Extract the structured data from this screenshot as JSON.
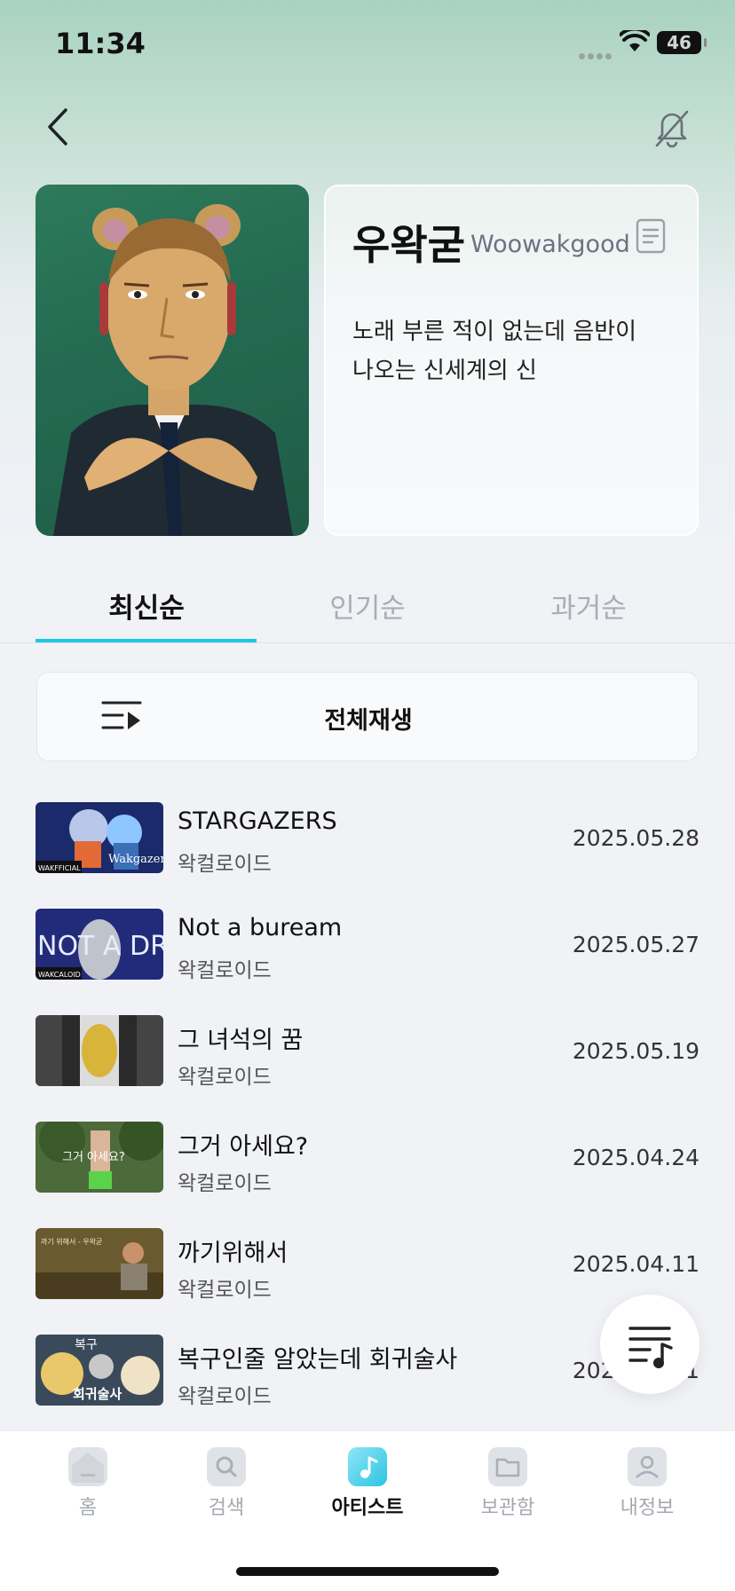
{
  "status_bar": {
    "time": "11:34",
    "battery": "46"
  },
  "artist": {
    "name": "우왁굳",
    "name_en": "Woowakgood",
    "description": "노래 부른 적이 없는데 음반이 나오는 신세계의 신"
  },
  "tabs": [
    {
      "label": "최신순",
      "active": true
    },
    {
      "label": "인기순",
      "active": false
    },
    {
      "label": "과거순",
      "active": false
    }
  ],
  "play_all_label": "전체재생",
  "songs": [
    {
      "title": "STARGAZERS",
      "artist": "왁컬로이드",
      "date": "2025.05.28"
    },
    {
      "title": "Not a buream",
      "artist": "왁컬로이드",
      "date": "2025.05.27"
    },
    {
      "title": "그 녀석의 꿈",
      "artist": "왁컬로이드",
      "date": "2025.05.19"
    },
    {
      "title": "그거 아세요?",
      "artist": "왁컬로이드",
      "date": "2025.04.24"
    },
    {
      "title": "까기위해서",
      "artist": "왁컬로이드",
      "date": "2025.04.11"
    },
    {
      "title": "복구인줄 알았는데 회귀술사",
      "artist": "왁컬로이드",
      "date": "2025.01.31"
    }
  ],
  "thumbnail_captions": {
    "s1": "Wakgazers",
    "s1b": "WAKFFICIAL",
    "s2": "NOT A DREAM",
    "s2b": "WAKCALOID",
    "s4": "그거 아세요?",
    "s5": "까기 위해서 - 우왁굳",
    "s6a": "복구",
    "s6b": "회귀술사"
  },
  "nav": [
    {
      "label": "홈",
      "icon": "home-icon",
      "active": false
    },
    {
      "label": "검색",
      "icon": "search-icon",
      "active": false
    },
    {
      "label": "아티스트",
      "icon": "artist-music-icon",
      "active": true
    },
    {
      "label": "보관함",
      "icon": "folder-icon",
      "active": false
    },
    {
      "label": "내정보",
      "icon": "profile-icon",
      "active": false
    }
  ],
  "colors": {
    "accent": "#1fc7e0",
    "background": "#f0f2f6"
  }
}
